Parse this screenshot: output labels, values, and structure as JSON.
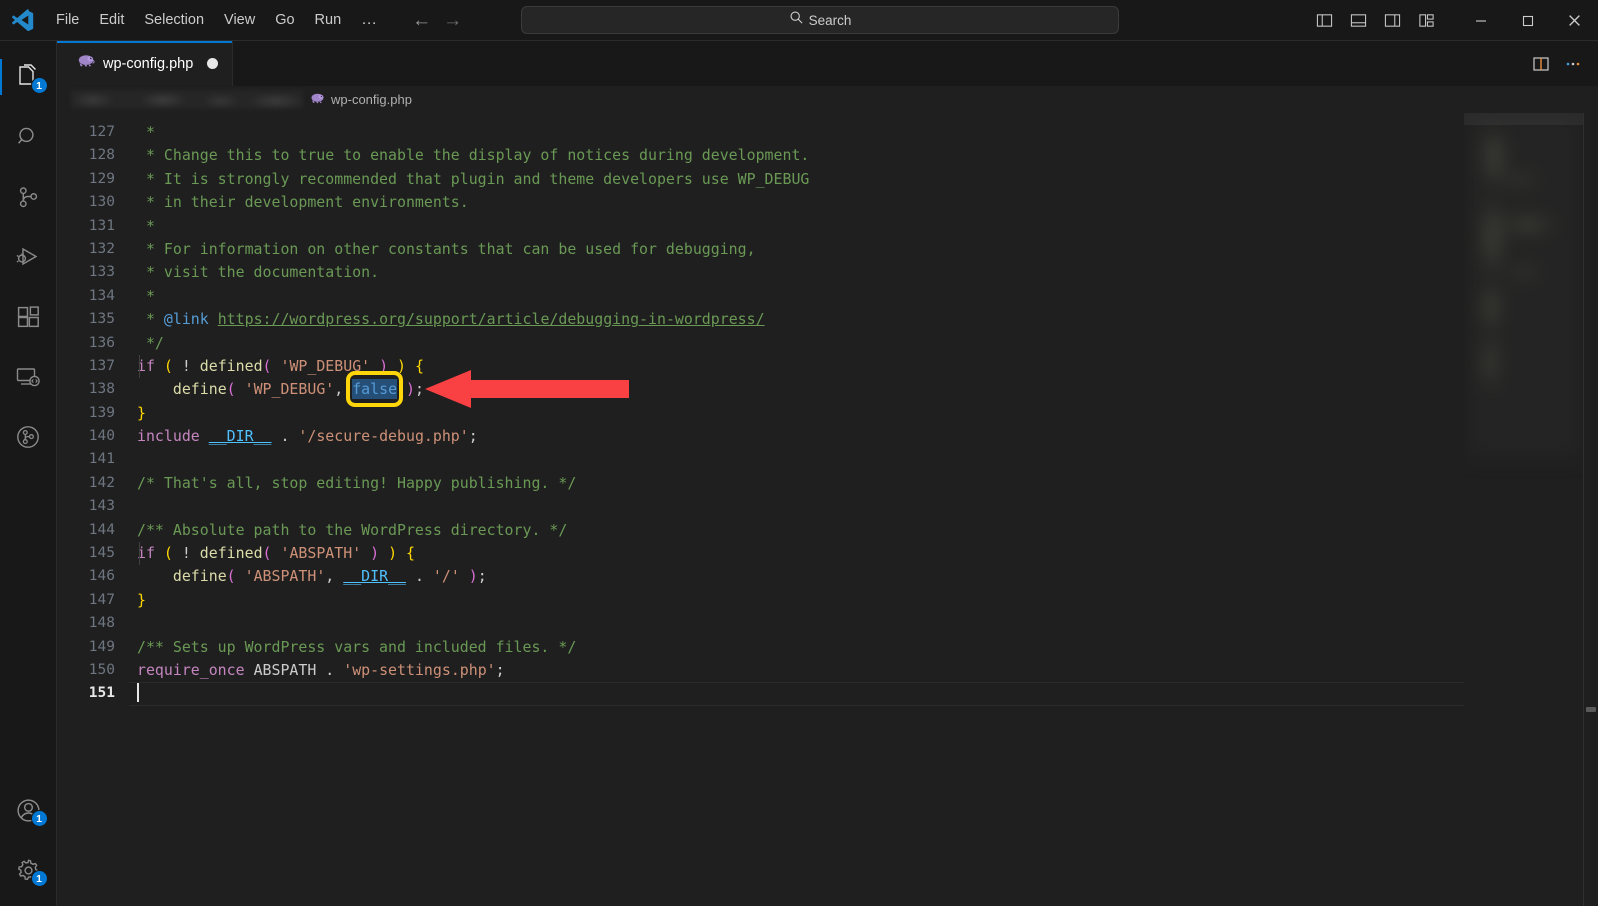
{
  "window": {
    "app_name": "Visual Studio Code",
    "menu": [
      "File",
      "Edit",
      "Selection",
      "View",
      "Go",
      "Run"
    ],
    "menu_overflow": "…",
    "nav_back": "←",
    "nav_forward": "→",
    "search": {
      "label": "Search",
      "icon": "search-icon"
    },
    "layout_toggles": [
      {
        "name": "toggle-primary-sidebar-icon"
      },
      {
        "name": "toggle-panel-icon"
      },
      {
        "name": "toggle-secondary-sidebar-icon"
      },
      {
        "name": "customize-layout-icon"
      }
    ],
    "controls": {
      "minimize": "—",
      "maximize": "□",
      "close": "✕"
    }
  },
  "activitybar": {
    "items": [
      {
        "name": "explorer",
        "icon": "files-icon",
        "badge": "1",
        "active": true
      },
      {
        "name": "search",
        "icon": "search-icon",
        "badge": null,
        "active": false
      },
      {
        "name": "source-control",
        "icon": "source-control-icon",
        "badge": null,
        "active": false
      },
      {
        "name": "run-and-debug",
        "icon": "debug-icon",
        "badge": null,
        "active": false
      },
      {
        "name": "extensions",
        "icon": "extensions-icon",
        "badge": null,
        "active": false
      },
      {
        "name": "remote-explorer",
        "icon": "remote-icon",
        "badge": null,
        "active": false
      },
      {
        "name": "timeline",
        "icon": "timeline-icon",
        "badge": null,
        "active": false
      }
    ],
    "bottom": [
      {
        "name": "accounts",
        "icon": "account-icon",
        "badge": "1"
      },
      {
        "name": "manage-settings",
        "icon": "gear-icon",
        "badge": "1"
      }
    ]
  },
  "tabs": [
    {
      "label": "wp-config.php",
      "icon": "php-elephant-icon",
      "dirty": true,
      "active": true
    }
  ],
  "editor_actions": [
    {
      "name": "split-editor-right",
      "icon": "split-editor-icon"
    },
    {
      "name": "more-actions",
      "icon": "ellipsis-icon"
    }
  ],
  "breadcrumb": {
    "redacted_path": true,
    "file": "wp-config.php",
    "file_icon": "php-elephant-icon"
  },
  "code": {
    "language": "php",
    "first_line": 127,
    "current_line": 151,
    "lines": [
      {
        "n": 127,
        "tokens": [
          {
            "t": " * ",
            "c": "t-comment"
          }
        ]
      },
      {
        "n": 128,
        "tokens": [
          {
            "t": " * Change this to true to enable the display of notices during development.",
            "c": "t-comment"
          }
        ]
      },
      {
        "n": 129,
        "tokens": [
          {
            "t": " * It is strongly recommended that plugin and theme developers use WP_DEBUG",
            "c": "t-comment"
          }
        ]
      },
      {
        "n": 130,
        "tokens": [
          {
            "t": " * in their development environments.",
            "c": "t-comment"
          }
        ]
      },
      {
        "n": 131,
        "tokens": [
          {
            "t": " * ",
            "c": "t-comment"
          }
        ]
      },
      {
        "n": 132,
        "tokens": [
          {
            "t": " * For information on other constants that can be used for debugging,",
            "c": "t-comment"
          }
        ]
      },
      {
        "n": 133,
        "tokens": [
          {
            "t": " * visit the documentation.",
            "c": "t-comment"
          }
        ]
      },
      {
        "n": 134,
        "tokens": [
          {
            "t": " * ",
            "c": "t-comment"
          }
        ]
      },
      {
        "n": 135,
        "tokens": [
          {
            "t": " * ",
            "c": "t-comment"
          },
          {
            "t": "@link",
            "c": "t-tag"
          },
          {
            "t": " ",
            "c": "t-comment"
          },
          {
            "t": "https://wordpress.org/support/article/debugging-in-wordpress/",
            "c": "t-link"
          }
        ]
      },
      {
        "n": 136,
        "tokens": [
          {
            "t": " */",
            "c": "t-comment"
          }
        ]
      },
      {
        "n": 137,
        "tokens": [
          {
            "t": "if",
            "c": "t-keyword"
          },
          {
            "t": " ",
            "c": "t-punc"
          },
          {
            "t": "(",
            "c": "t-paren1"
          },
          {
            "t": " ! ",
            "c": "t-punc"
          },
          {
            "t": "defined",
            "c": "t-func"
          },
          {
            "t": "(",
            "c": "t-paren2"
          },
          {
            "t": " ",
            "c": "t-punc"
          },
          {
            "t": "'WP_DEBUG'",
            "c": "t-string"
          },
          {
            "t": " ",
            "c": "t-punc"
          },
          {
            "t": ")",
            "c": "t-paren2"
          },
          {
            "t": " ",
            "c": "t-punc"
          },
          {
            "t": ")",
            "c": "t-paren1"
          },
          {
            "t": " ",
            "c": "t-punc"
          },
          {
            "t": "{",
            "c": "t-brace"
          }
        ]
      },
      {
        "n": 138,
        "tokens": [
          {
            "t": "    ",
            "c": "t-punc"
          },
          {
            "t": "define",
            "c": "t-func"
          },
          {
            "t": "(",
            "c": "t-paren2"
          },
          {
            "t": " ",
            "c": "t-punc"
          },
          {
            "t": "'WP_DEBUG'",
            "c": "t-string"
          },
          {
            "t": ", ",
            "c": "t-punc"
          },
          {
            "t": "false",
            "c": "sel-false"
          },
          {
            "t": " ",
            "c": "t-punc"
          },
          {
            "t": ")",
            "c": "t-paren2"
          },
          {
            "t": ";",
            "c": "t-punc"
          }
        ]
      },
      {
        "n": 139,
        "tokens": [
          {
            "t": "}",
            "c": "t-brace"
          }
        ]
      },
      {
        "n": 140,
        "tokens": [
          {
            "t": "include",
            "c": "t-keyword"
          },
          {
            "t": " ",
            "c": "t-punc"
          },
          {
            "t": "__DIR__",
            "c": "t-magic"
          },
          {
            "t": " . ",
            "c": "t-punc"
          },
          {
            "t": "'/secure-debug.php'",
            "c": "t-string"
          },
          {
            "t": ";",
            "c": "t-punc"
          }
        ]
      },
      {
        "n": 141,
        "tokens": [
          {
            "t": "",
            "c": "t-punc"
          }
        ]
      },
      {
        "n": 142,
        "tokens": [
          {
            "t": "/* That's all, stop editing! Happy publishing. */",
            "c": "t-comment"
          }
        ]
      },
      {
        "n": 143,
        "tokens": [
          {
            "t": "",
            "c": "t-punc"
          }
        ]
      },
      {
        "n": 144,
        "tokens": [
          {
            "t": "/** Absolute path to the WordPress directory. */",
            "c": "t-comment"
          }
        ]
      },
      {
        "n": 145,
        "tokens": [
          {
            "t": "if",
            "c": "t-keyword"
          },
          {
            "t": " ",
            "c": "t-punc"
          },
          {
            "t": "(",
            "c": "t-paren1"
          },
          {
            "t": " ! ",
            "c": "t-punc"
          },
          {
            "t": "defined",
            "c": "t-func"
          },
          {
            "t": "(",
            "c": "t-paren2"
          },
          {
            "t": " ",
            "c": "t-punc"
          },
          {
            "t": "'ABSPATH'",
            "c": "t-string"
          },
          {
            "t": " ",
            "c": "t-punc"
          },
          {
            "t": ")",
            "c": "t-paren2"
          },
          {
            "t": " ",
            "c": "t-punc"
          },
          {
            "t": ")",
            "c": "t-paren1"
          },
          {
            "t": " ",
            "c": "t-punc"
          },
          {
            "t": "{",
            "c": "t-brace"
          }
        ]
      },
      {
        "n": 146,
        "tokens": [
          {
            "t": "    ",
            "c": "t-punc"
          },
          {
            "t": "define",
            "c": "t-func"
          },
          {
            "t": "(",
            "c": "t-paren2"
          },
          {
            "t": " ",
            "c": "t-punc"
          },
          {
            "t": "'ABSPATH'",
            "c": "t-string"
          },
          {
            "t": ", ",
            "c": "t-punc"
          },
          {
            "t": "__DIR__",
            "c": "t-magic"
          },
          {
            "t": " . ",
            "c": "t-punc"
          },
          {
            "t": "'/'",
            "c": "t-string"
          },
          {
            "t": " ",
            "c": "t-punc"
          },
          {
            "t": ")",
            "c": "t-paren2"
          },
          {
            "t": ";",
            "c": "t-punc"
          }
        ]
      },
      {
        "n": 147,
        "tokens": [
          {
            "t": "}",
            "c": "t-brace"
          }
        ]
      },
      {
        "n": 148,
        "tokens": [
          {
            "t": "",
            "c": "t-punc"
          }
        ]
      },
      {
        "n": 149,
        "tokens": [
          {
            "t": "/** Sets up WordPress vars and included files. */",
            "c": "t-comment"
          }
        ]
      },
      {
        "n": 150,
        "tokens": [
          {
            "t": "require_once",
            "c": "t-keyword"
          },
          {
            "t": " ",
            "c": "t-punc"
          },
          {
            "t": "ABSPATH",
            "c": "t-punc"
          },
          {
            "t": " . ",
            "c": "t-punc"
          },
          {
            "t": "'wp-settings.php'",
            "c": "t-string"
          },
          {
            "t": ";",
            "c": "t-punc"
          }
        ]
      },
      {
        "n": 151,
        "tokens": [
          {
            "t": "",
            "c": "t-punc"
          }
        ]
      }
    ]
  },
  "annotations": {
    "highlight_box": {
      "target_text": "false",
      "color": "#ffd60a",
      "line": 138
    },
    "arrow": {
      "color": "#f94144",
      "direction": "left",
      "points_at": "false"
    }
  },
  "colors": {
    "accent": "#0078d4",
    "editor_bg": "#1f1f1f",
    "chrome_bg": "#181818",
    "highlight": "#ffd60a",
    "arrow": "#f94144",
    "selection": "#264f78"
  }
}
